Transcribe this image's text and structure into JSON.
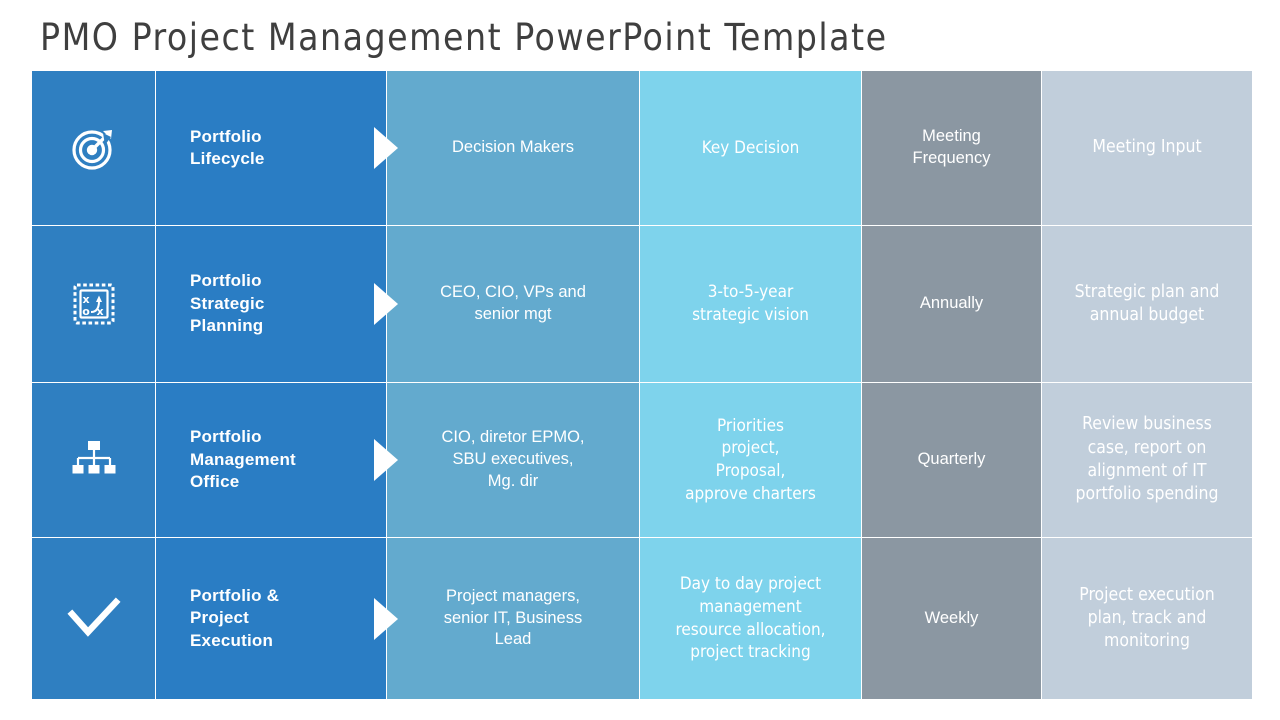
{
  "slide": {
    "title": "PMO Project Management PowerPoint Template"
  },
  "columns": {
    "headers": [
      "",
      "",
      "Decision Makers",
      "Key Decision",
      "Meeting Frequency",
      "Meeting Input"
    ],
    "colors": {
      "icon": "#2f7fc1",
      "stage": "#2a7dc4",
      "decision_makers": "#63aace",
      "key_decision": "#7ed3ec",
      "meeting_frequency": "#8b97a2",
      "meeting_input": "#c1cedb",
      "arrow": "#ffffff",
      "text": "#ffffff",
      "title": "#3f3f3f"
    }
  },
  "rows": [
    {
      "icon": "target-arrow-icon",
      "stage": "Portfolio\nLifecycle",
      "decision_makers": "Decision Makers",
      "key_decision": "Key Decision",
      "meeting_frequency": "Meeting\nFrequency",
      "meeting_input": "Meeting Input"
    },
    {
      "icon": "strategy-board-icon",
      "stage": "Portfolio\nStrategic\nPlanning",
      "decision_makers": "CEO, CIO, VPs and\nsenior mgt",
      "key_decision": "3-to-5-year\nstrategic vision",
      "meeting_frequency": "Annually",
      "meeting_input": "Strategic plan and\nannual budget"
    },
    {
      "icon": "org-chart-icon",
      "stage": "Portfolio\nManagement\nOffice",
      "decision_makers": "CIO, diretor EPMO,\nSBU executives,\nMg. dir",
      "key_decision": "Priorities\nproject,\nProposal,\napprove charters",
      "meeting_frequency": "Quarterly",
      "meeting_input": "Review business\ncase, report on\nalignment of IT\nportfolio spending"
    },
    {
      "icon": "checkmark-icon",
      "stage": "Portfolio &\nProject\nExecution",
      "decision_makers": "Project managers,\nsenior IT, Business\nLead",
      "key_decision": "Day to day project\nmanagement\nresource allocation,\nproject tracking",
      "meeting_frequency": "Weekly",
      "meeting_input": "Project execution\nplan, track and\nmonitoring"
    }
  ]
}
